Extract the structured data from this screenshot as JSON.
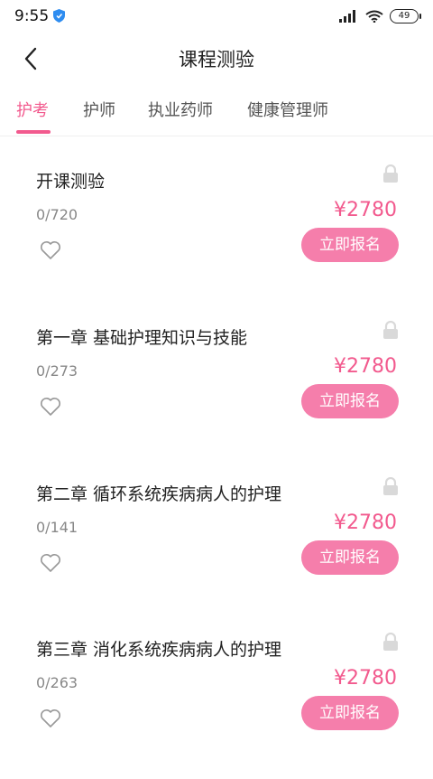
{
  "status": {
    "time": "9:55",
    "battery": "49"
  },
  "header": {
    "title": "课程测验"
  },
  "tabs": [
    {
      "label": "护考",
      "active": true
    },
    {
      "label": "护师",
      "active": false
    },
    {
      "label": "执业药师",
      "active": false
    },
    {
      "label": "健康管理师",
      "active": false
    }
  ],
  "courses": [
    {
      "title": "开课测验",
      "progress": "0/720",
      "price": "¥2780",
      "button": "立即报名"
    },
    {
      "title": "第一章 基础护理知识与技能",
      "progress": "0/273",
      "price": "¥2780",
      "button": "立即报名"
    },
    {
      "title": "第二章 循环系统疾病病人的护理",
      "progress": "0/141",
      "price": "¥2780",
      "button": "立即报名"
    },
    {
      "title": "第三章 消化系统疾病病人的护理",
      "progress": "0/263",
      "price": "¥2780",
      "button": "立即报名"
    }
  ],
  "icons": {
    "back": "back-arrow-icon",
    "lock": "lock-icon",
    "heart": "heart-icon",
    "shield": "shield-icon",
    "signal": "signal-icon",
    "wifi": "wifi-icon",
    "battery": "battery-icon"
  },
  "colors": {
    "accent": "#f25a8e",
    "button": "#f57eab",
    "lock": "#d9d9d9"
  }
}
